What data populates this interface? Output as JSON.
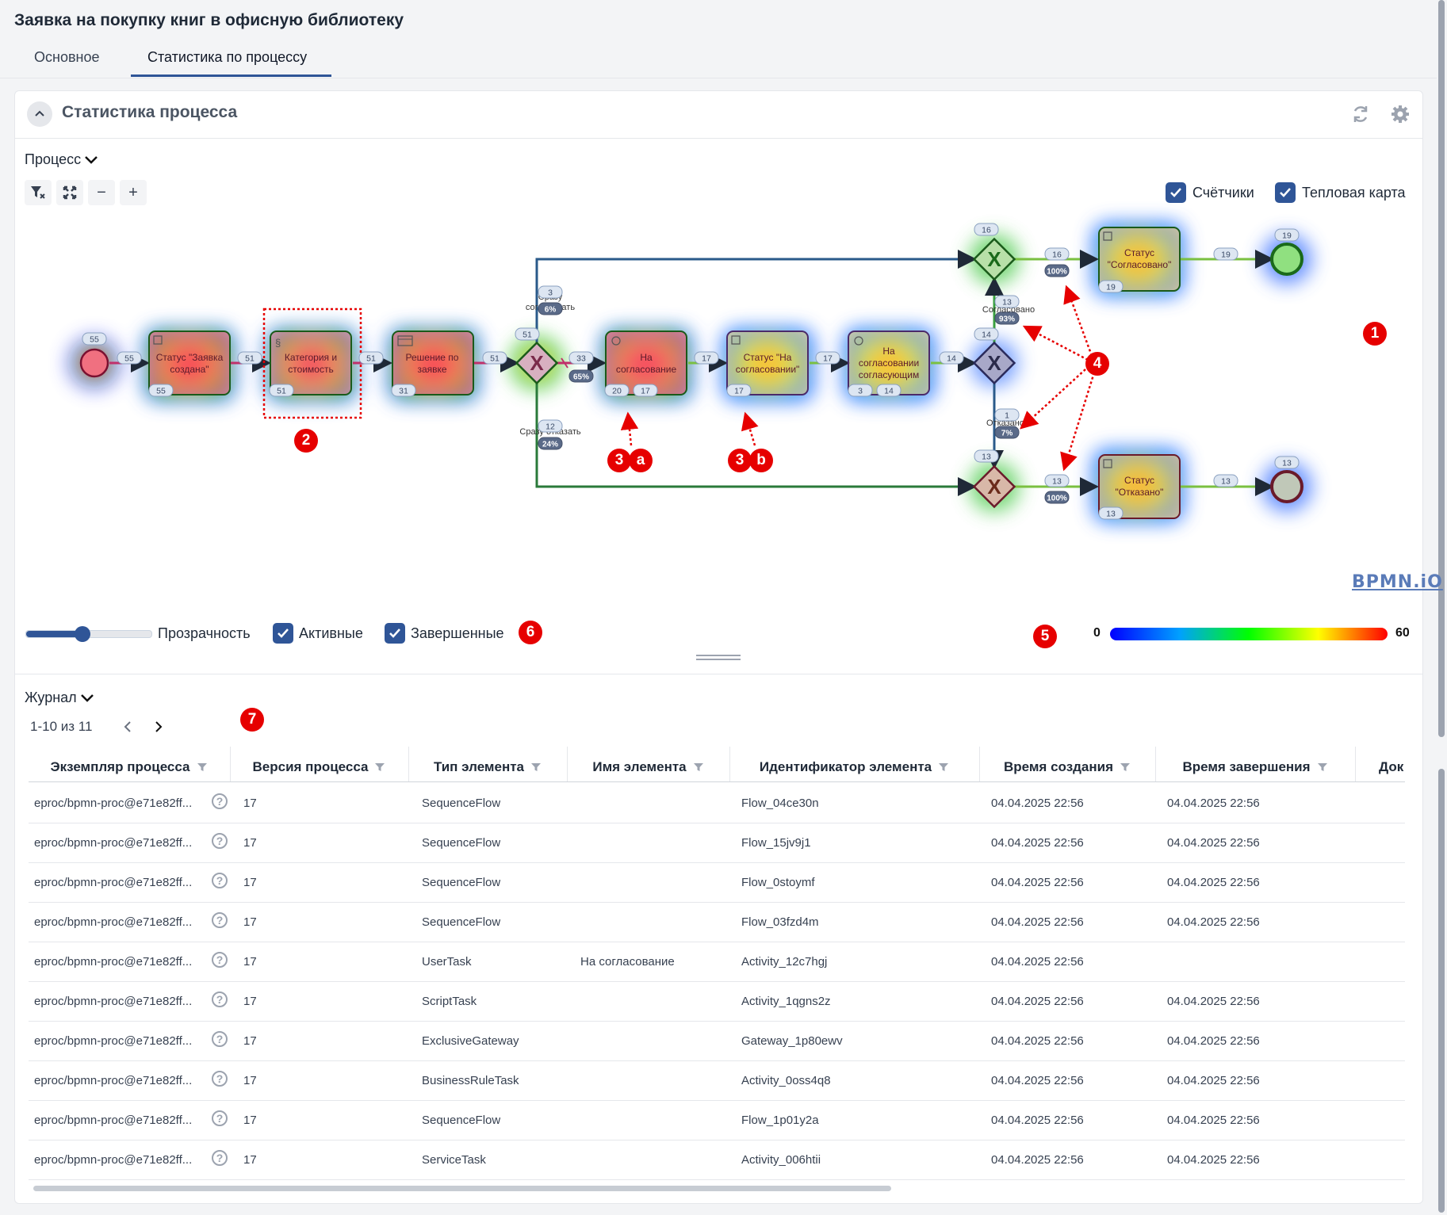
{
  "page": {
    "title": "Заявка на покупку книг в офисную библиотеку",
    "tabs": [
      {
        "label": "Основное",
        "active": false
      },
      {
        "label": "Статистика по процессу",
        "active": true
      }
    ]
  },
  "widget": {
    "title": "Статистика процесса",
    "collapse_icon": "chevron-up-icon",
    "refresh_icon": "refresh-icon",
    "settings_icon": "gear-icon"
  },
  "process": {
    "section_label": "Процесс",
    "toolbar": [
      "filter-clear-icon",
      "fit-screen-icon",
      "zoom-out-icon",
      "zoom-in-icon"
    ],
    "zoom_out_label": "−",
    "zoom_in_label": "+",
    "checkbox_counters": {
      "label": "Счётчики",
      "checked": true
    },
    "checkbox_heatmap": {
      "label": "Тепловая карта",
      "checked": true
    },
    "opacity_label": "Прозрачность",
    "opacity_value": 0.45,
    "checkbox_active": {
      "label": "Активные",
      "checked": true
    },
    "checkbox_completed": {
      "label": "Завершенные",
      "checked": true
    },
    "legend_min": "0",
    "legend_max": "60",
    "watermark": "BPMN.iO"
  },
  "diagram": {
    "tasks": {
      "t1": {
        "label": [
          "Статус \"Заявка",
          "создана\""
        ],
        "count": "55"
      },
      "t2": {
        "label": [
          "Категория и",
          "стоимость"
        ],
        "count": "51"
      },
      "t3": {
        "label": [
          "Решение по",
          "заявке"
        ],
        "count": "31"
      },
      "t4": {
        "label": [
          "На",
          "согласование"
        ],
        "count_active": "20",
        "count": "17"
      },
      "t5": {
        "label": [
          "Статус \"На",
          "согласовании\""
        ],
        "count": "17"
      },
      "t6": {
        "label": [
          "На",
          "согласовании",
          "согласующим"
        ],
        "count_active": "3",
        "count": "14"
      },
      "t7": {
        "label": [
          "Статус",
          "\"Согласовано\""
        ],
        "count": "19"
      },
      "t8": {
        "label": [
          "Статус",
          "\"Отказано\""
        ],
        "count": "13"
      }
    },
    "start_count": "55",
    "end_ok_count": "19",
    "end_rej_count": "13",
    "flows": {
      "f1": "55",
      "f2": "51",
      "f3": "51",
      "f4": "51",
      "f5": "33",
      "f6": "17",
      "f7": "17",
      "f8": "14",
      "f9": "16",
      "f10": "19",
      "f11": "13",
      "f12": "13",
      "gw1": "51",
      "gw2": "16",
      "gw3": "14",
      "gw4": "13",
      "top_count": "3",
      "bottom_count": "12",
      "up_count": "13",
      "down_count": "1"
    },
    "percents": {
      "p1": "65%",
      "p2": "6%",
      "p3": "24%",
      "p4": "100%",
      "p5": "93%",
      "p6": "7%",
      "p7": "100%"
    },
    "flow_labels": {
      "top": [
        "Сразу",
        "согласовать"
      ],
      "bottom": "Сразу отказать",
      "approved": "Согласовано",
      "rejected": "Отказано"
    },
    "annotations": [
      "1",
      "2",
      "3",
      "a",
      "3",
      "b",
      "4",
      "5",
      "6",
      "7"
    ]
  },
  "journal": {
    "section_label": "Журнал",
    "pagination": "1-10 из 11",
    "columns": [
      "Экземпляр процесса",
      "Версия процесса",
      "Тип элемента",
      "Имя элемента",
      "Идентификатор элемента",
      "Время создания",
      "Время завершения",
      "Док"
    ],
    "rows": [
      {
        "instance": "eproc/bpmn-proc@e71e82ff...",
        "version": "17",
        "type": "SequenceFlow",
        "name": "",
        "id": "Flow_04ce30n",
        "created": "04.04.2025 22:56",
        "completed": "04.04.2025 22:56"
      },
      {
        "instance": "eproc/bpmn-proc@e71e82ff...",
        "version": "17",
        "type": "SequenceFlow",
        "name": "",
        "id": "Flow_15jv9j1",
        "created": "04.04.2025 22:56",
        "completed": "04.04.2025 22:56"
      },
      {
        "instance": "eproc/bpmn-proc@e71e82ff...",
        "version": "17",
        "type": "SequenceFlow",
        "name": "",
        "id": "Flow_0stoymf",
        "created": "04.04.2025 22:56",
        "completed": "04.04.2025 22:56"
      },
      {
        "instance": "eproc/bpmn-proc@e71e82ff...",
        "version": "17",
        "type": "SequenceFlow",
        "name": "",
        "id": "Flow_03fzd4m",
        "created": "04.04.2025 22:56",
        "completed": "04.04.2025 22:56"
      },
      {
        "instance": "eproc/bpmn-proc@e71e82ff...",
        "version": "17",
        "type": "UserTask",
        "name": "На согласование",
        "id": "Activity_12c7hgj",
        "created": "04.04.2025 22:56",
        "completed": ""
      },
      {
        "instance": "eproc/bpmn-proc@e71e82ff...",
        "version": "17",
        "type": "ScriptTask",
        "name": "",
        "id": "Activity_1qgns2z",
        "created": "04.04.2025 22:56",
        "completed": "04.04.2025 22:56"
      },
      {
        "instance": "eproc/bpmn-proc@e71e82ff...",
        "version": "17",
        "type": "ExclusiveGateway",
        "name": "",
        "id": "Gateway_1p80ewv",
        "created": "04.04.2025 22:56",
        "completed": "04.04.2025 22:56"
      },
      {
        "instance": "eproc/bpmn-proc@e71e82ff...",
        "version": "17",
        "type": "BusinessRuleTask",
        "name": "",
        "id": "Activity_0oss4q8",
        "created": "04.04.2025 22:56",
        "completed": "04.04.2025 22:56"
      },
      {
        "instance": "eproc/bpmn-proc@e71e82ff...",
        "version": "17",
        "type": "SequenceFlow",
        "name": "",
        "id": "Flow_1p01y2a",
        "created": "04.04.2025 22:56",
        "completed": "04.04.2025 22:56"
      },
      {
        "instance": "eproc/bpmn-proc@e71e82ff...",
        "version": "17",
        "type": "ServiceTask",
        "name": "",
        "id": "Activity_006htii",
        "created": "04.04.2025 22:56",
        "completed": "04.04.2025 22:56"
      }
    ]
  },
  "colors": {
    "accent": "#2f5597",
    "annotation": "#e60000",
    "heat_high": "#ff2a2a",
    "heat_mid": "#ffe600",
    "heat_low": "#32d232",
    "heat_edge": "#2a5cff"
  }
}
